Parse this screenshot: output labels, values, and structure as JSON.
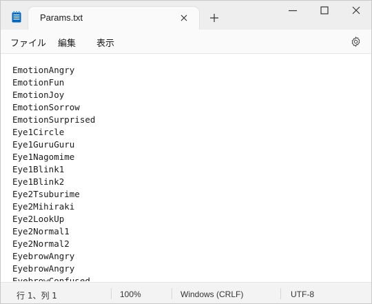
{
  "window": {
    "tab_title": "Params.txt",
    "accent_color": "#0067c0"
  },
  "icons": {
    "app": "notepad-icon",
    "tab_close": "close-icon",
    "new_tab": "plus-icon",
    "minimize": "minimize-icon",
    "maximize": "maximize-icon",
    "close": "close-icon",
    "settings": "gear-icon"
  },
  "menu": {
    "file": "ファイル",
    "edit": "編集",
    "view": "表示"
  },
  "editor": {
    "lines": [
      "EmotionAngry",
      "EmotionFun",
      "EmotionJoy",
      "EmotionSorrow",
      "EmotionSurprised",
      "Eye1Circle",
      "Eye1GuruGuru",
      "Eye1Nagomime",
      "Eye1Blink1",
      "Eye1Blink2",
      "Eye2Tsuburime",
      "Eye2Mihiraki",
      "Eye2LookUp",
      "Eye2Normal1",
      "Eye2Normal2",
      "EyebrowAngry",
      "EyebrowAngry",
      "EyebrowConfused"
    ]
  },
  "status": {
    "position": "行 1、列 1",
    "zoom": "100%",
    "line_ending": "Windows (CRLF)",
    "encoding": "UTF-8"
  }
}
